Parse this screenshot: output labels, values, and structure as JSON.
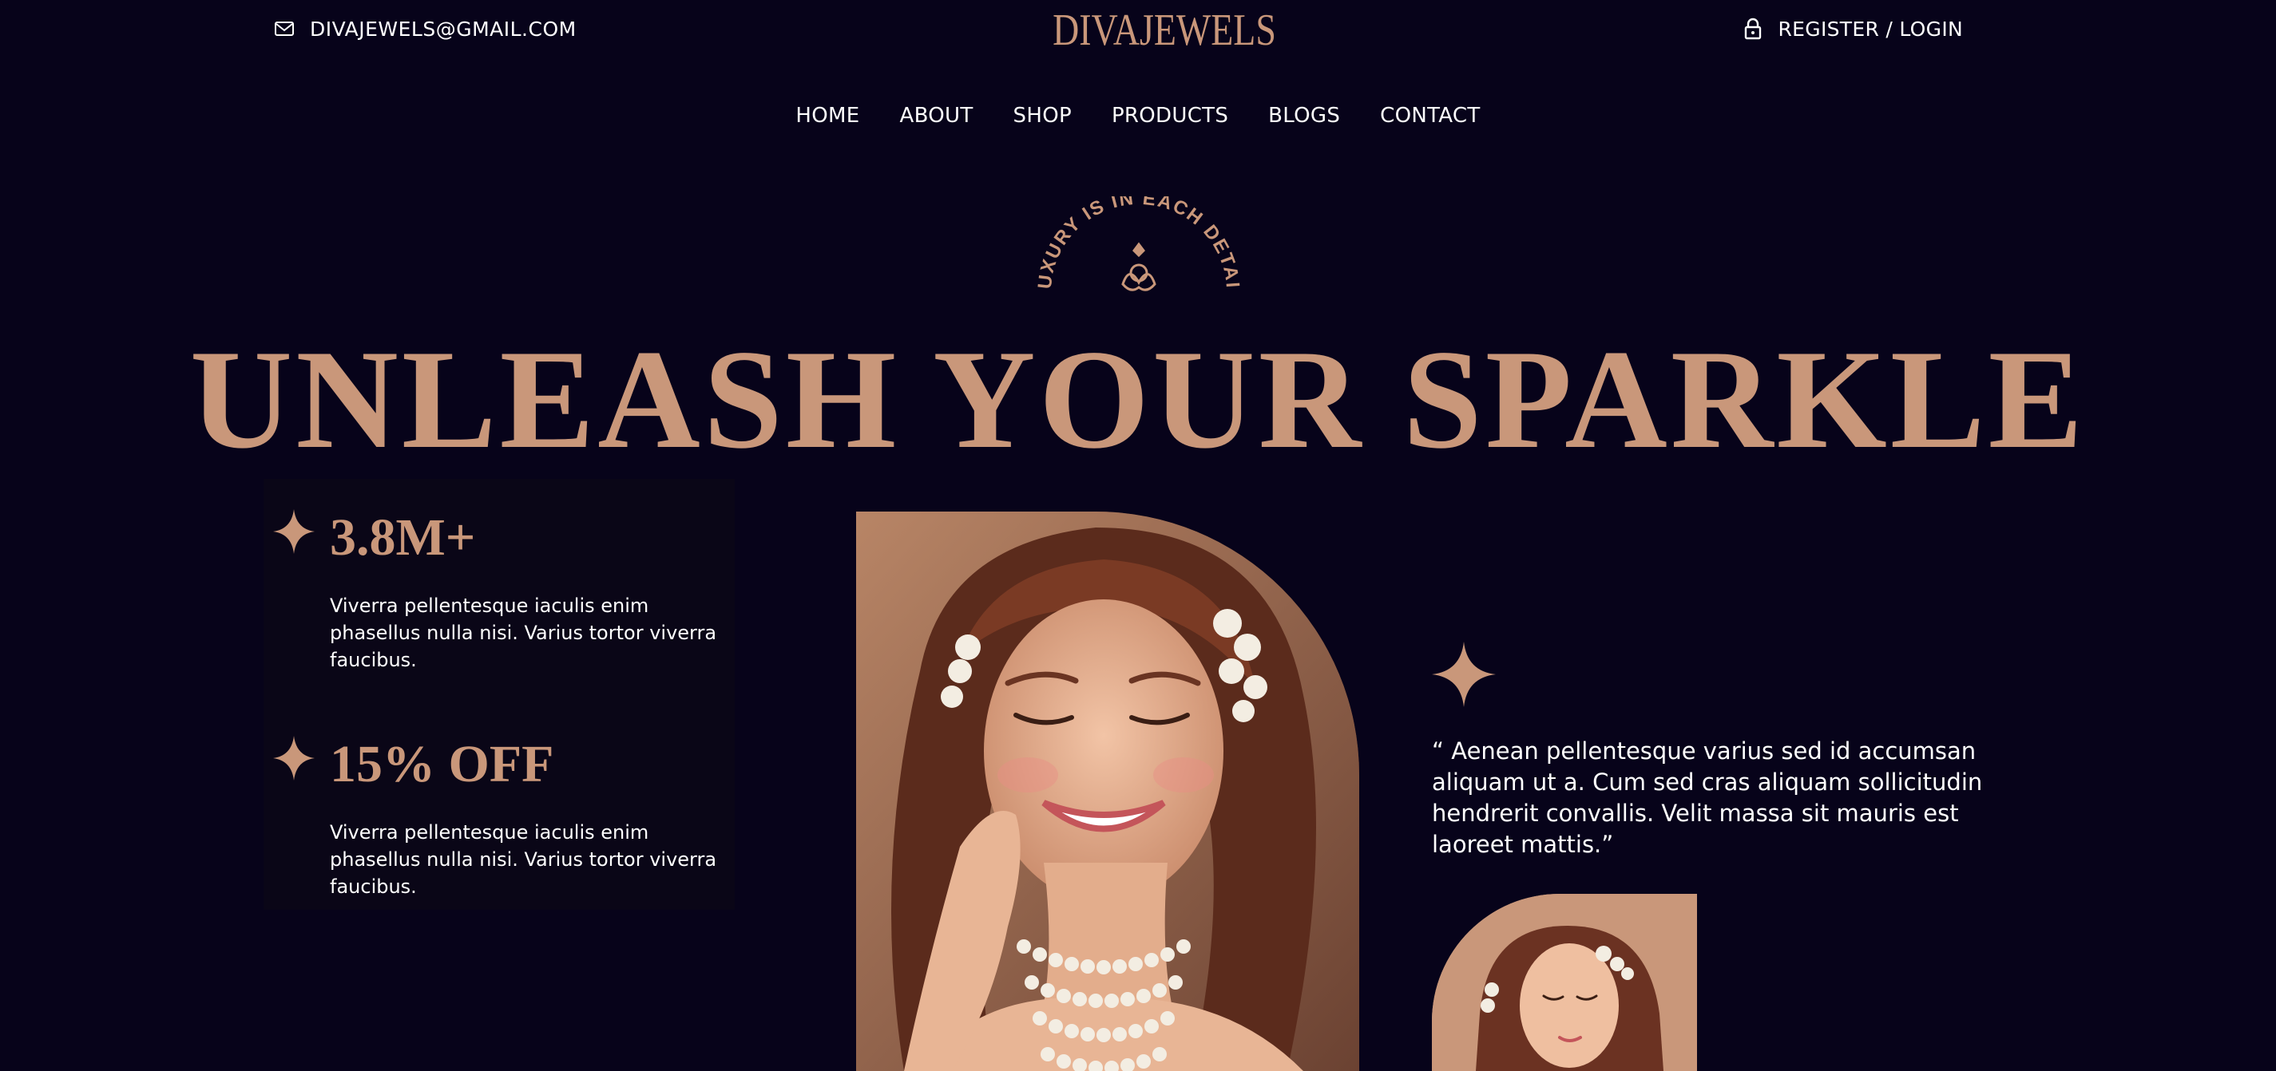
{
  "topbar": {
    "email": "DIVAJEWELS@GMAIL.COM",
    "logo": "DIVAJEWELS",
    "login": "REGISTER / LOGIN"
  },
  "nav": {
    "items": [
      "HOME",
      "ABOUT",
      "SHOP",
      "PRODUCTS",
      "BLOGS",
      "CONTACT"
    ]
  },
  "badge": {
    "text": "LUXURY IS IN EACH DETAIL"
  },
  "hero": {
    "headline": "UNLEASH YOUR SPARKLE"
  },
  "stats": [
    {
      "value": "3.8M+",
      "description": "Viverra pellentesque iaculis enim phasellus nulla nisi. Varius tortor viverra faucibus."
    },
    {
      "value": "15% OFF",
      "description": "Viverra pellentesque iaculis enim phasellus nulla nisi. Varius tortor viverra faucibus."
    }
  ],
  "quote": {
    "text": "“ Aenean pellentesque varius sed id accumsan aliquam ut a. Cum sed cras aliquam sollicitudin hendrerit convallis. Velit massa sit mauris est laoreet mattis.”"
  },
  "icons": {
    "email": "mail-icon",
    "login": "lock-icon",
    "star": "sparkle-star-icon"
  },
  "colors": {
    "background": "#07031a",
    "accent": "#c9977a",
    "text": "#ffffff"
  }
}
